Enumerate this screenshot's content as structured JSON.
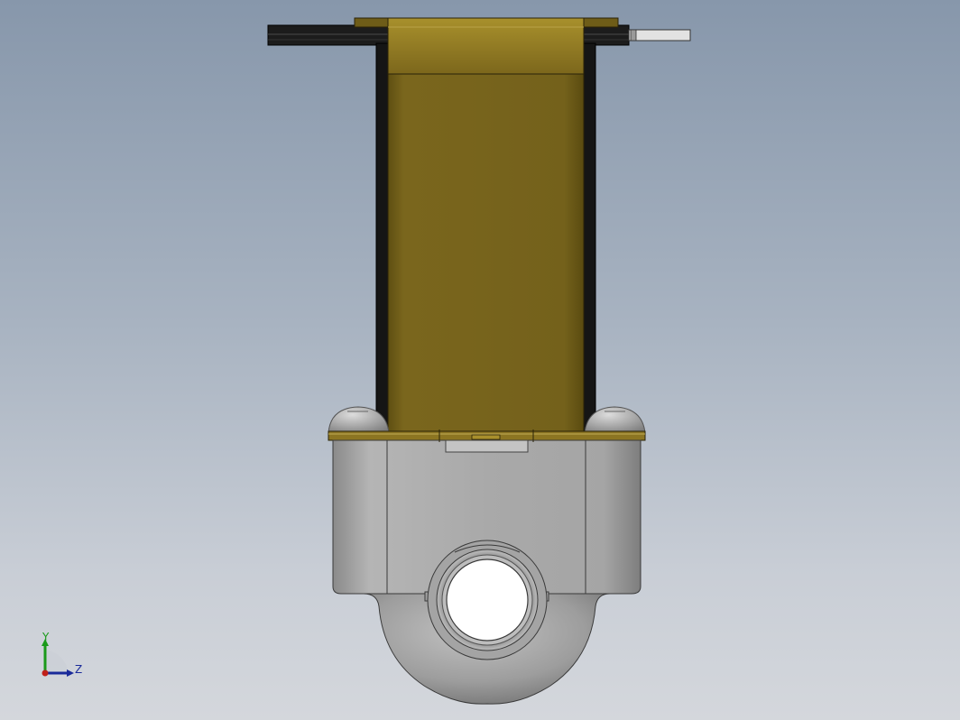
{
  "viewport": {
    "background_top": "#8797ab",
    "background_bottom": "#d4d7dc"
  },
  "model": {
    "description_icon": "solenoid-valve-model",
    "coil_color": "#74611b",
    "coil_highlight": "#9a8530",
    "frame_color": "#1e1e1e",
    "body_color": "#a9a9a9",
    "body_shade": "#8c8c8c"
  },
  "triad": {
    "y_label": "Y",
    "z_label": "Z",
    "y_color": "#1a9a1a",
    "z_color": "#1a2a9a",
    "x_color": "#c0201a"
  }
}
